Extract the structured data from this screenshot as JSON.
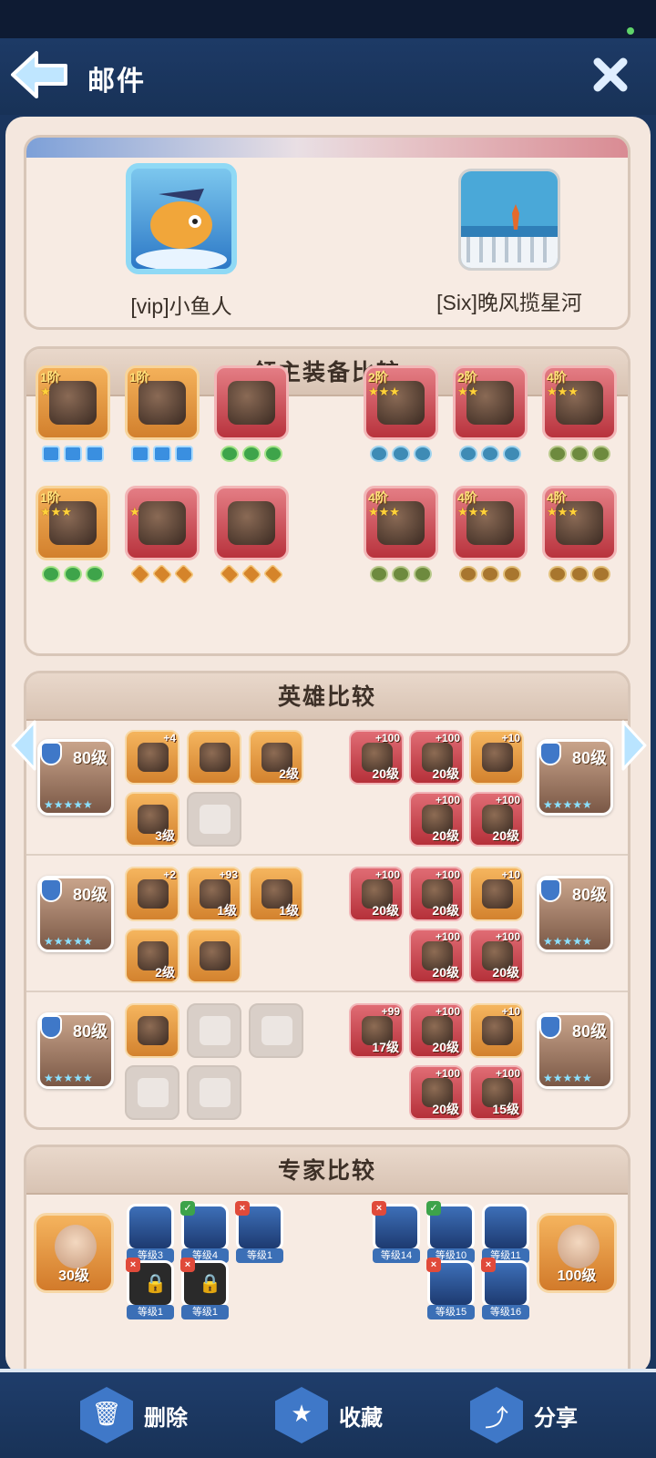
{
  "header": {
    "title": "邮件",
    "back_icon": "back-arrow-icon",
    "close_icon": "close-icon"
  },
  "players": {
    "left": {
      "name": "[vip]小鱼人"
    },
    "right": {
      "name": "[Six]晚风揽星河"
    }
  },
  "sections": {
    "equipment": "领主装备比较",
    "heroes": "英雄比较",
    "experts": "专家比较"
  },
  "equipment": {
    "left": [
      {
        "tier": "1阶",
        "stars": 1,
        "color": "orange",
        "gems": [
          "blue",
          "blue",
          "blue"
        ]
      },
      {
        "tier": "1阶",
        "stars": 0,
        "color": "orange",
        "gems": [
          "blue",
          "blue",
          "blue"
        ]
      },
      {
        "tier": "",
        "stars": 0,
        "color": "red",
        "gems": [
          "green",
          "green",
          "green"
        ]
      },
      {
        "tier": "1阶",
        "stars": 3,
        "color": "orange",
        "gems": [
          "green",
          "green",
          "green"
        ]
      },
      {
        "tier": "",
        "stars": 1,
        "color": "red",
        "gems": [
          "orange",
          "orange",
          "orange"
        ]
      },
      {
        "tier": "",
        "stars": 0,
        "color": "red",
        "gems": [
          "orange",
          "orange",
          "orange"
        ]
      }
    ],
    "right": [
      {
        "tier": "2阶",
        "stars": 3,
        "color": "red",
        "gems": [
          "teal",
          "teal",
          "teal"
        ]
      },
      {
        "tier": "2阶",
        "stars": 2,
        "color": "red",
        "gems": [
          "teal",
          "teal",
          "teal"
        ]
      },
      {
        "tier": "4阶",
        "stars": 3,
        "color": "red",
        "gems": [
          "olive",
          "olive",
          "olive"
        ]
      },
      {
        "tier": "4阶",
        "stars": 3,
        "color": "red",
        "gems": [
          "olive",
          "olive",
          "olive"
        ]
      },
      {
        "tier": "4阶",
        "stars": 3,
        "color": "red",
        "gems": [
          "bronze",
          "bronze",
          "bronze"
        ]
      },
      {
        "tier": "4阶",
        "stars": 3,
        "color": "red",
        "gems": [
          "bronze",
          "bronze",
          "bronze"
        ]
      }
    ]
  },
  "heroes": [
    {
      "left": {
        "level": "80级",
        "stars": "★★★★★",
        "items": [
          {
            "c": "o",
            "plus": "+4",
            "lvl": ""
          },
          {
            "c": "o",
            "plus": "",
            "lvl": ""
          },
          {
            "c": "o",
            "plus": "",
            "lvl": "2级"
          },
          {
            "c": "o",
            "plus": "",
            "lvl": "3级"
          },
          {
            "c": "g",
            "plus": "",
            "lvl": ""
          }
        ]
      },
      "right": {
        "level": "80级",
        "stars": "★★★★★",
        "items": [
          {
            "c": "r",
            "plus": "+100",
            "lvl": "20级"
          },
          {
            "c": "r",
            "plus": "+100",
            "lvl": "20级"
          },
          {
            "c": "o",
            "plus": "+10",
            "lvl": ""
          },
          {
            "c": "r",
            "plus": "+100",
            "lvl": "20级"
          },
          {
            "c": "r",
            "plus": "+100",
            "lvl": "20级"
          }
        ]
      }
    },
    {
      "left": {
        "level": "80级",
        "stars": "★★★★★",
        "items": [
          {
            "c": "o",
            "plus": "+2",
            "lvl": ""
          },
          {
            "c": "o",
            "plus": "+93",
            "lvl": "1级"
          },
          {
            "c": "o",
            "plus": "",
            "lvl": "1级"
          },
          {
            "c": "o",
            "plus": "",
            "lvl": "2级"
          },
          {
            "c": "o",
            "plus": "",
            "lvl": ""
          }
        ]
      },
      "right": {
        "level": "80级",
        "stars": "★★★★★",
        "items": [
          {
            "c": "r",
            "plus": "+100",
            "lvl": "20级"
          },
          {
            "c": "r",
            "plus": "+100",
            "lvl": "20级"
          },
          {
            "c": "o",
            "plus": "+10",
            "lvl": ""
          },
          {
            "c": "r",
            "plus": "+100",
            "lvl": "20级"
          },
          {
            "c": "r",
            "plus": "+100",
            "lvl": "20级"
          }
        ]
      }
    },
    {
      "left": {
        "level": "80级",
        "stars": "★★★★★",
        "items": [
          {
            "c": "o",
            "plus": "",
            "lvl": ""
          },
          {
            "c": "g",
            "plus": "",
            "lvl": ""
          },
          {
            "c": "g",
            "plus": "",
            "lvl": ""
          },
          {
            "c": "g",
            "plus": "",
            "lvl": ""
          },
          {
            "c": "g",
            "plus": "",
            "lvl": ""
          }
        ]
      },
      "right": {
        "level": "80级",
        "stars": "★★★★★",
        "items": [
          {
            "c": "r",
            "plus": "+99",
            "lvl": "17级"
          },
          {
            "c": "r",
            "plus": "+100",
            "lvl": "20级"
          },
          {
            "c": "o",
            "plus": "+10",
            "lvl": ""
          },
          {
            "c": "r",
            "plus": "+100",
            "lvl": "20级"
          },
          {
            "c": "r",
            "plus": "+100",
            "lvl": "15级"
          }
        ]
      }
    }
  ],
  "experts": {
    "left": {
      "level": "30级",
      "skills": [
        {
          "tag": "",
          "name": "等级3",
          "locked": false
        },
        {
          "tag": "ok",
          "name": "等级4",
          "locked": false
        },
        {
          "tag": "x",
          "name": "等级1",
          "locked": false
        },
        {
          "tag": "x",
          "name": "等级1",
          "locked": true
        },
        {
          "tag": "x",
          "name": "等级1",
          "locked": true
        }
      ]
    },
    "right": {
      "level": "100级",
      "skills": [
        {
          "tag": "x",
          "name": "等级14",
          "locked": false
        },
        {
          "tag": "ok",
          "name": "等级10",
          "locked": false
        },
        {
          "tag": "",
          "name": "等级11",
          "locked": false
        },
        {
          "tag": "x",
          "name": "等级15",
          "locked": false
        },
        {
          "tag": "x",
          "name": "等级16",
          "locked": false
        }
      ]
    }
  },
  "bottombar": {
    "delete": "删除",
    "favorite": "收藏",
    "share": "分享"
  }
}
